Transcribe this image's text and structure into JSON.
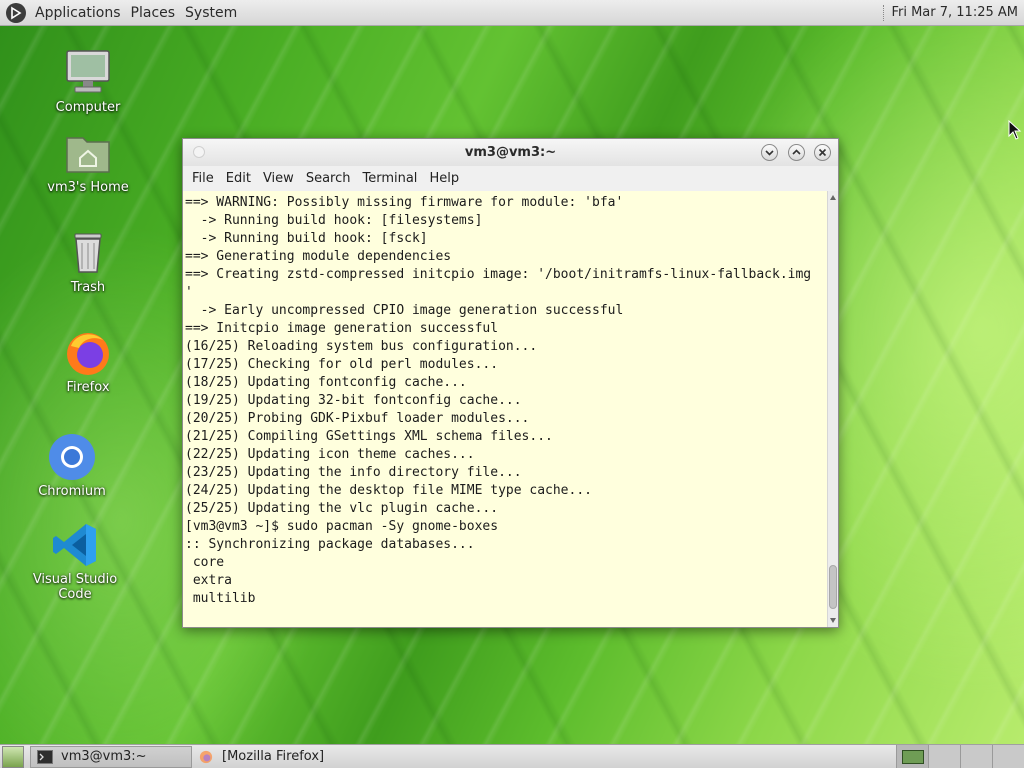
{
  "top_panel": {
    "menus": [
      "Applications",
      "Places",
      "System"
    ],
    "clock": "Fri Mar  7, 11:25 AM"
  },
  "desktop_icons": [
    {
      "label": "Computer",
      "icon": "computer-icon"
    },
    {
      "label": "vm3's Home",
      "icon": "home-folder-icon"
    },
    {
      "label": "Trash",
      "icon": "trash-icon"
    },
    {
      "label": "Firefox",
      "icon": "firefox-icon"
    },
    {
      "label": "Chromium",
      "icon": "chromium-icon"
    },
    {
      "label": "Visual Studio Code",
      "icon": "vscode-icon"
    }
  ],
  "terminal": {
    "title": "vm3@vm3:~",
    "menu": [
      "File",
      "Edit",
      "View",
      "Search",
      "Terminal",
      "Help"
    ],
    "lines": [
      "==> WARNING: Possibly missing firmware for module: 'bfa'",
      "  -> Running build hook: [filesystems]",
      "  -> Running build hook: [fsck]",
      "==> Generating module dependencies",
      "==> Creating zstd-compressed initcpio image: '/boot/initramfs-linux-fallback.img",
      "'",
      "  -> Early uncompressed CPIO image generation successful",
      "==> Initcpio image generation successful",
      "(16/25) Reloading system bus configuration...",
      "(17/25) Checking for old perl modules...",
      "(18/25) Updating fontconfig cache...",
      "(19/25) Updating 32-bit fontconfig cache...",
      "(20/25) Probing GDK-Pixbuf loader modules...",
      "(21/25) Compiling GSettings XML schema files...",
      "(22/25) Updating icon theme caches...",
      "(23/25) Updating the info directory file...",
      "(24/25) Updating the desktop file MIME type cache...",
      "(25/25) Updating the vlc plugin cache...",
      "[vm3@vm3 ~]$ sudo pacman -Sy gnome-boxes",
      ":: Synchronizing package databases...",
      " core",
      " extra",
      " multilib"
    ]
  },
  "taskbar": {
    "tasks": [
      {
        "label": "vm3@vm3:~",
        "icon": "terminal-icon",
        "active": true
      },
      {
        "label": "[Mozilla Firefox]",
        "icon": "firefox-icon",
        "active": false
      }
    ]
  },
  "colors": {
    "terminal_bg": "#ffffdd",
    "desktop_green": "#4aae24"
  }
}
